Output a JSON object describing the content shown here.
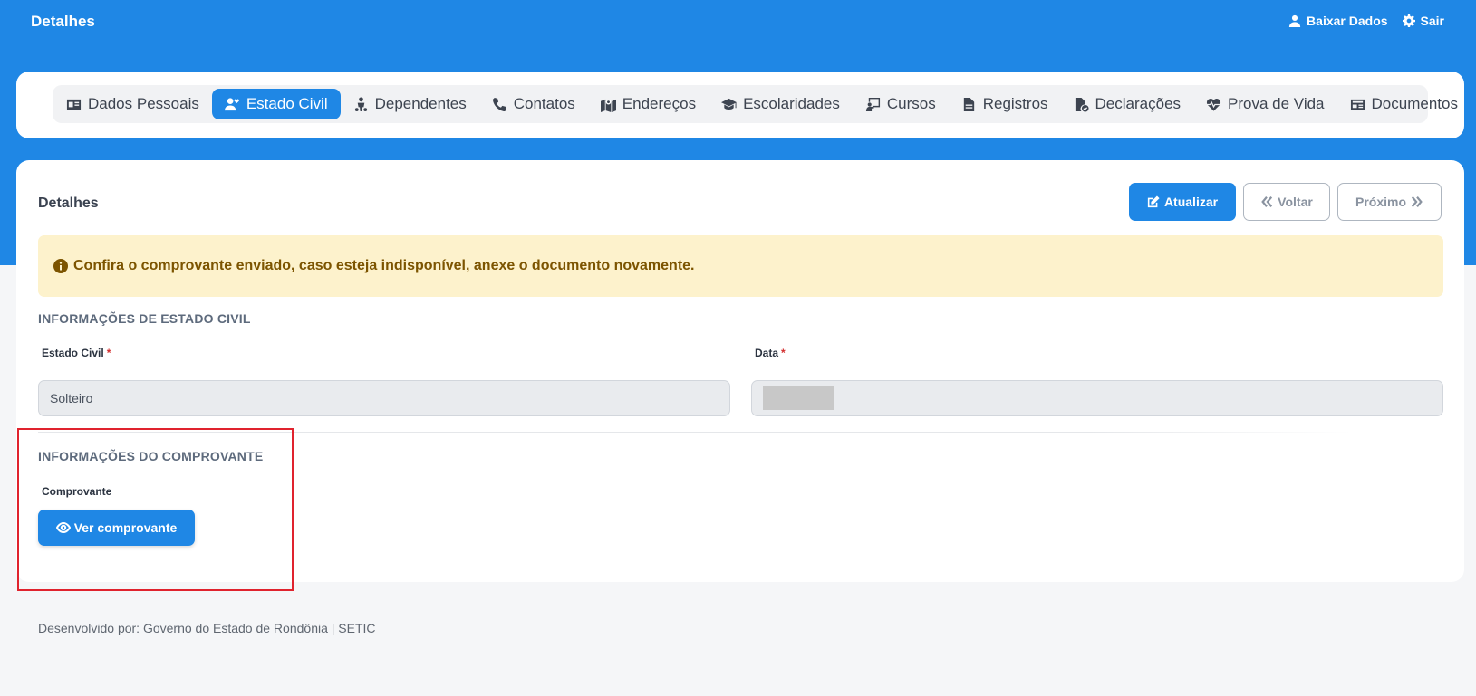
{
  "header": {
    "title": "Detalhes",
    "download_label": "Baixar Dados",
    "logout_label": "Sair"
  },
  "tabs": [
    {
      "label": "Dados Pessoais",
      "icon": "id-card-icon",
      "active": false
    },
    {
      "label": "Estado Civil",
      "icon": "user-heart-icon",
      "active": true
    },
    {
      "label": "Dependentes",
      "icon": "child-icon",
      "active": false
    },
    {
      "label": "Contatos",
      "icon": "phone-icon",
      "active": false
    },
    {
      "label": "Endereços",
      "icon": "map-icon",
      "active": false
    },
    {
      "label": "Escolaridades",
      "icon": "graduation-cap-icon",
      "active": false
    },
    {
      "label": "Cursos",
      "icon": "chalkboard-icon",
      "active": false
    },
    {
      "label": "Registros",
      "icon": "file-icon",
      "active": false
    },
    {
      "label": "Declarações",
      "icon": "file-check-icon",
      "active": false
    },
    {
      "label": "Prova de Vida",
      "icon": "heart-pulse-icon",
      "active": false
    },
    {
      "label": "Documentos",
      "icon": "document-card-icon",
      "active": false
    }
  ],
  "main": {
    "title": "Detalhes",
    "update_label": "Atualizar",
    "back_label": "Voltar",
    "next_label": "Próximo",
    "alert_text": "Confira o comprovante enviado, caso esteja indisponível, anexe o documento novamente.",
    "section_civil": "INFORMAÇÕES DE ESTADO CIVIL",
    "estado_civil_label": "Estado Civil",
    "estado_civil_value": "Solteiro",
    "data_label": "Data",
    "required_mark": "*",
    "section_proof": "INFORMAÇÕES DO COMPROVANTE",
    "proof_label": "Comprovante",
    "view_proof_label": "Ver comprovante"
  },
  "footer": {
    "text": "Desenvolvido por: Governo do Estado de Rondônia | SETIC"
  },
  "colors": {
    "primary": "#1f87e5",
    "alert_bg": "#fdf2cc",
    "alert_text": "#7c5400",
    "highlight": "#e0232e"
  }
}
